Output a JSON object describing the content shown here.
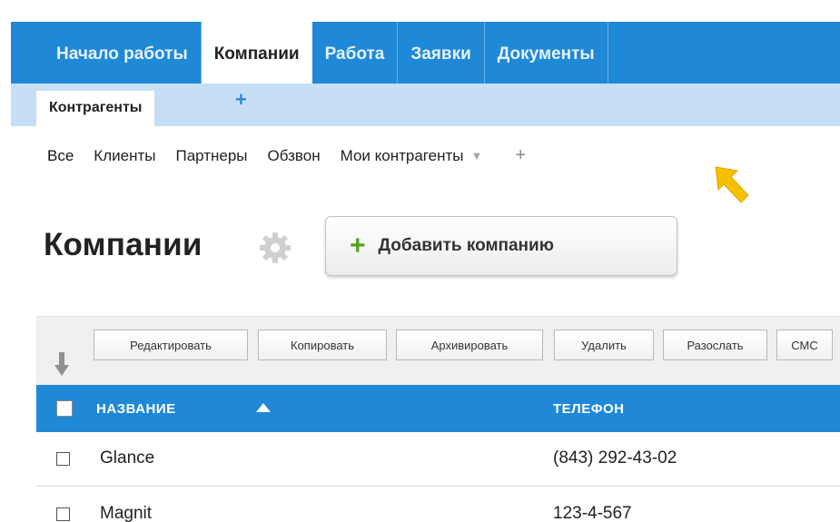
{
  "main_tabs": [
    {
      "label": "Начало работы"
    },
    {
      "label": "Компании"
    },
    {
      "label": "Работа"
    },
    {
      "label": "Заявки"
    },
    {
      "label": "Документы"
    }
  ],
  "sub_tabs": {
    "active": "Контрагенты",
    "add": "+"
  },
  "filters": {
    "items": [
      "Все",
      "Клиенты",
      "Партнеры",
      "Обзвон",
      "Мои контрагенты"
    ],
    "dropdown_glyph": "▼",
    "add": "+"
  },
  "page": {
    "title": "Компании",
    "add_button_icon": "+",
    "add_button_label": "Добавить компанию"
  },
  "toolbar": {
    "buttons": [
      "Редактировать",
      "Копировать",
      "Архивировать",
      "Удалить",
      "Разослать",
      "СМС"
    ]
  },
  "table": {
    "columns": {
      "name": "НАЗВАНИЕ",
      "phone": "ТЕЛЕФОН"
    },
    "rows": [
      {
        "name": "Glance",
        "phone": "(843) 292-43-02"
      },
      {
        "name": "Magnit",
        "phone": "123-4-567"
      }
    ]
  },
  "icons": {
    "gear": "gear-icon",
    "sort": "sort-down-icon",
    "pointer": "arrow-pointer-icon"
  },
  "colors": {
    "primary_blue": "#1f88d7",
    "light_blue": "#c6dff5",
    "add_green": "#4da41a",
    "pointer_yellow": "#f6c000"
  }
}
